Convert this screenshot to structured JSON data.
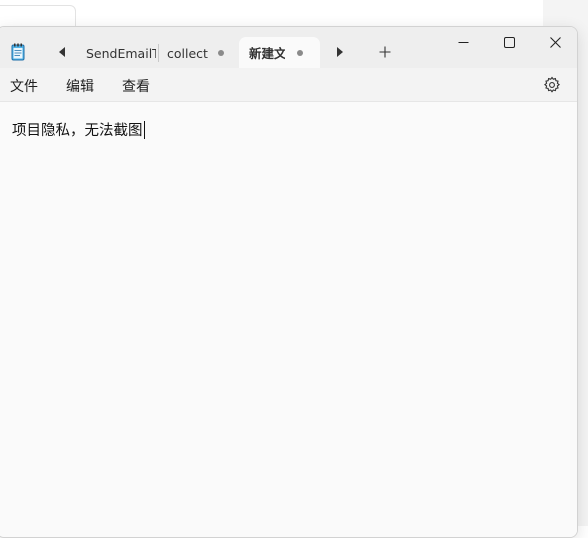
{
  "tabs": [
    {
      "label": "SendEmailTc"
    },
    {
      "label": "collect"
    },
    {
      "label": "新建文"
    }
  ],
  "menu": {
    "file": "文件",
    "edit": "编辑",
    "view": "查看"
  },
  "editor": {
    "text": "项目隐私，无法截图"
  },
  "icons": {
    "app": "notepad-icon",
    "scroll_left": "triangle-left-icon",
    "scroll_right": "triangle-right-icon",
    "new_tab": "plus-icon",
    "minimize": "minimize-icon",
    "maximize": "maximize-icon",
    "close": "close-icon",
    "settings": "gear-icon"
  },
  "colors": {
    "window_bg": "#fafafa",
    "titlebar_bg": "#eeeeee",
    "menubar_bg": "#f3f3f3",
    "unsaved_dot": "#8a8a8a"
  }
}
